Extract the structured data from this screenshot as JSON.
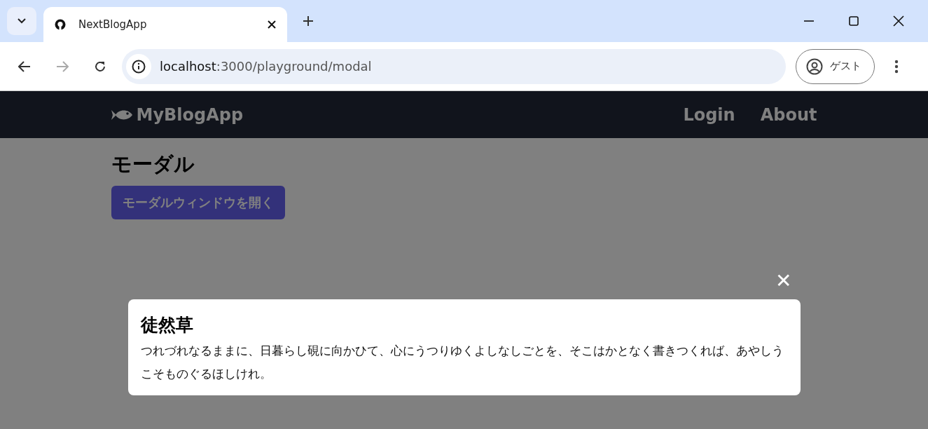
{
  "browser": {
    "tab": {
      "title": "NextBlogApp",
      "selected": true
    },
    "address": {
      "host": "localhost",
      "path": ":3000/playground/modal"
    },
    "profile": "ゲスト"
  },
  "navbar": {
    "brand": "MyBlogApp",
    "links": [
      "Login",
      "About"
    ]
  },
  "page": {
    "title": "モーダル",
    "open_button": "モーダルウィンドウを開く"
  },
  "modal": {
    "close": "✕",
    "title": "徒然草",
    "body": "つれづれなるままに、日暮らし硯に向かひて、心にうつりゆくよしなしごとを、そこはかとなく書きつくれば、あやしうこそものぐるほしけれ。"
  }
}
